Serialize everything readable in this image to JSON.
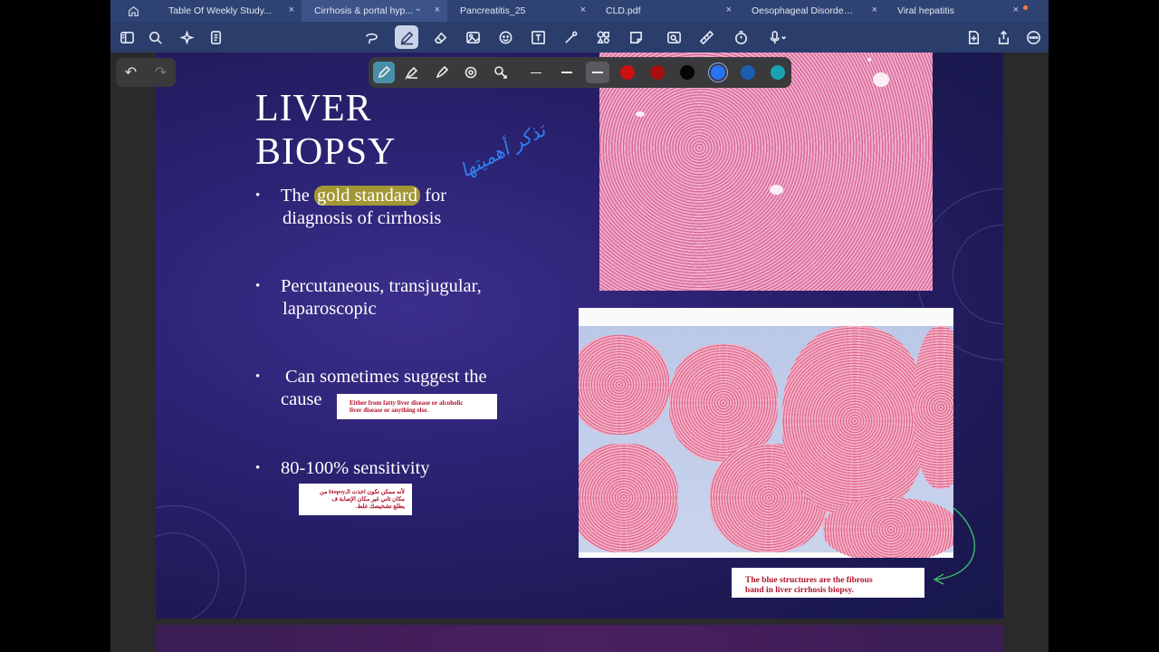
{
  "tabs": [
    {
      "label": "Table Of Weekly Study...",
      "active": false
    },
    {
      "label": "Cirrhosis & portal hyp...",
      "active": true
    },
    {
      "label": "Pancreatitis_25",
      "active": false
    },
    {
      "label": "CLD.pdf",
      "active": false
    },
    {
      "label": "Oesophageal Disorders...",
      "active": false
    },
    {
      "label": "Viral hepatitis",
      "active": false
    }
  ],
  "icons": {
    "home": "home-icon",
    "close": "×",
    "chevron": "⌄"
  },
  "pen_colors": [
    "#cc1111",
    "#a80f0f",
    "#050505",
    "#2a72f5",
    "#1b5fb0",
    "#1aa3b3"
  ],
  "slide": {
    "title_line1": "LIVER",
    "title_line2": "BIOPSY",
    "bullet_glyph": "•",
    "bullet1_pre": "The ",
    "bullet1_highlight": "gold standard",
    "bullet1_post": " for",
    "bullet1_line2": "diagnosis of cirrhosis",
    "bullet2_line1": "Percutaneous, transjugular,",
    "bullet2_line2": "laparoscopic",
    "bullet3_line1": "Can sometimes suggest the",
    "bullet3_line2": "cause",
    "bullet4": "80-100% sensitivity",
    "note_cause_line1": "Either from fatty liver disease or alcoholic",
    "note_cause_line2": "liver disease or anything else.",
    "note_sensitivity_line1": "لأنه ممكن تكون اخذت الـbiopsy من",
    "note_sensitivity_line2": "مكان ثاني غير مكان الإصابة ف",
    "note_sensitivity_line3": "يطلع تشخيصك غلط.",
    "note_fibrous_line1": "The blue structures are the fibrous",
    "note_fibrous_line2": "band in liver cirrhosis biopsy.",
    "handwritten_note": "تذكر أهميتها"
  }
}
